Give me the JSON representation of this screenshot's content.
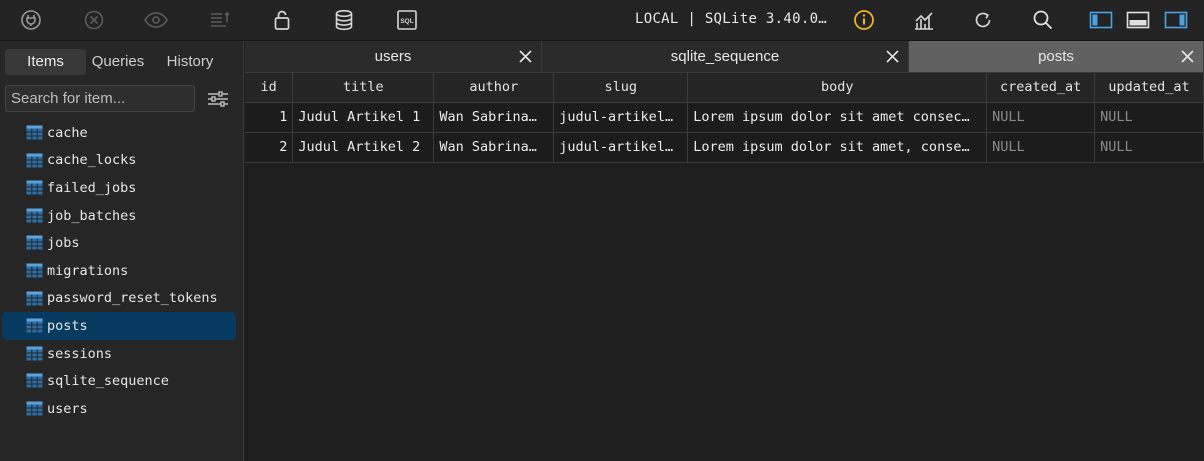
{
  "toolbar": {
    "icons": [
      "connect-icon",
      "disconnect-icon",
      "eye-icon",
      "format-icon",
      "lock-icon",
      "database-icon",
      "sql-icon",
      "info-icon",
      "chart-icon",
      "refresh-icon",
      "search-icon",
      "layout-left-icon",
      "layout-bottom-icon",
      "layout-right-icon"
    ],
    "connection_label": "LOCAL | SQLite 3.40.0…",
    "sql_icon_text": "SQL",
    "info_color": "#f0b429",
    "accent_color": "#4aa3e0"
  },
  "sidebar": {
    "tabs": [
      {
        "label": "Items"
      },
      {
        "label": "Queries"
      },
      {
        "label": "History"
      }
    ],
    "search_placeholder": "Search for item...",
    "items": [
      {
        "label": "cache"
      },
      {
        "label": "cache_locks"
      },
      {
        "label": "failed_jobs"
      },
      {
        "label": "job_batches"
      },
      {
        "label": "jobs"
      },
      {
        "label": "migrations"
      },
      {
        "label": "password_reset_tokens"
      },
      {
        "label": "posts"
      },
      {
        "label": "sessions"
      },
      {
        "label": "sqlite_sequence"
      },
      {
        "label": "users"
      }
    ],
    "selected": "posts"
  },
  "main": {
    "tabs": [
      {
        "label": "users"
      },
      {
        "label": "sqlite_sequence"
      },
      {
        "label": "posts"
      }
    ],
    "active_tab": "posts",
    "columns": [
      "id",
      "title",
      "author",
      "slug",
      "body",
      "created_at",
      "updated_at"
    ],
    "rows": [
      [
        "1",
        "Judul Artikel 1",
        "Wan Sabrina…",
        "judul-artikel…",
        "Lorem ipsum dolor sit amet consec…",
        "NULL",
        "NULL"
      ],
      [
        "2",
        "Judul Artikel 2",
        "Wan Sabrina…",
        "judul-artikel…",
        "Lorem ipsum dolor sit amet, conse…",
        "NULL",
        "NULL"
      ]
    ]
  }
}
